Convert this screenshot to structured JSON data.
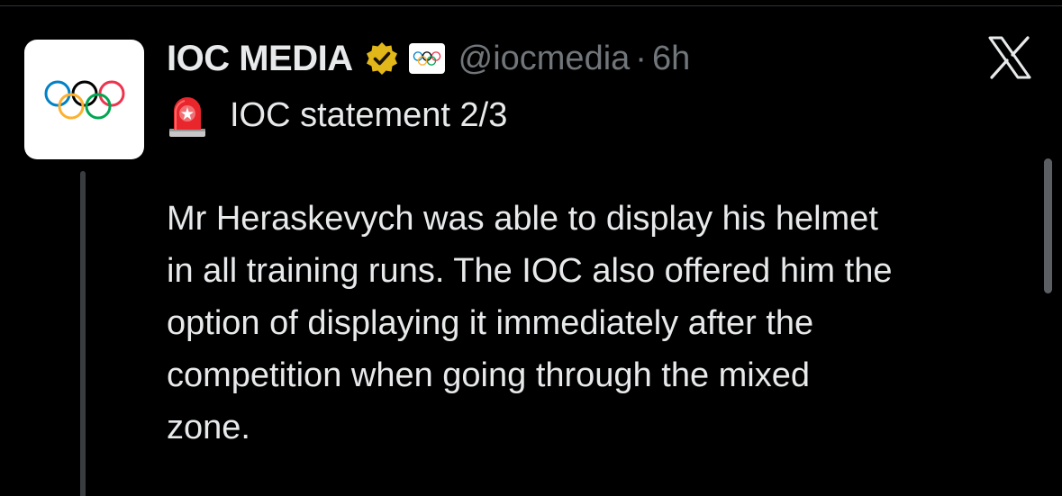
{
  "post": {
    "author": {
      "display_name": "IOC MEDIA",
      "handle": "@iocmedia",
      "separator": "·",
      "time": "6h",
      "avatar_icon": "olympic-rings-icon",
      "verified_badge_icon": "gold-verified-badge-icon",
      "org_badge_icon": "olympic-rings-icon"
    },
    "statement_icon": "siren-icon",
    "statement_title": "IOC statement 2/3",
    "body_lines": [
      "Mr Heraskevych was able to display his helmet",
      "in all training runs. The IOC also offered him the",
      "option of displaying it immediately after the",
      "competition when going through the mixed",
      "zone."
    ]
  },
  "platform_logo": "x-logo-icon",
  "colors": {
    "background": "#000000",
    "text_primary": "#e7e9ea",
    "text_secondary": "#71767b",
    "verified_gold": "#e2b719",
    "thread_line": "#3a3d40"
  }
}
